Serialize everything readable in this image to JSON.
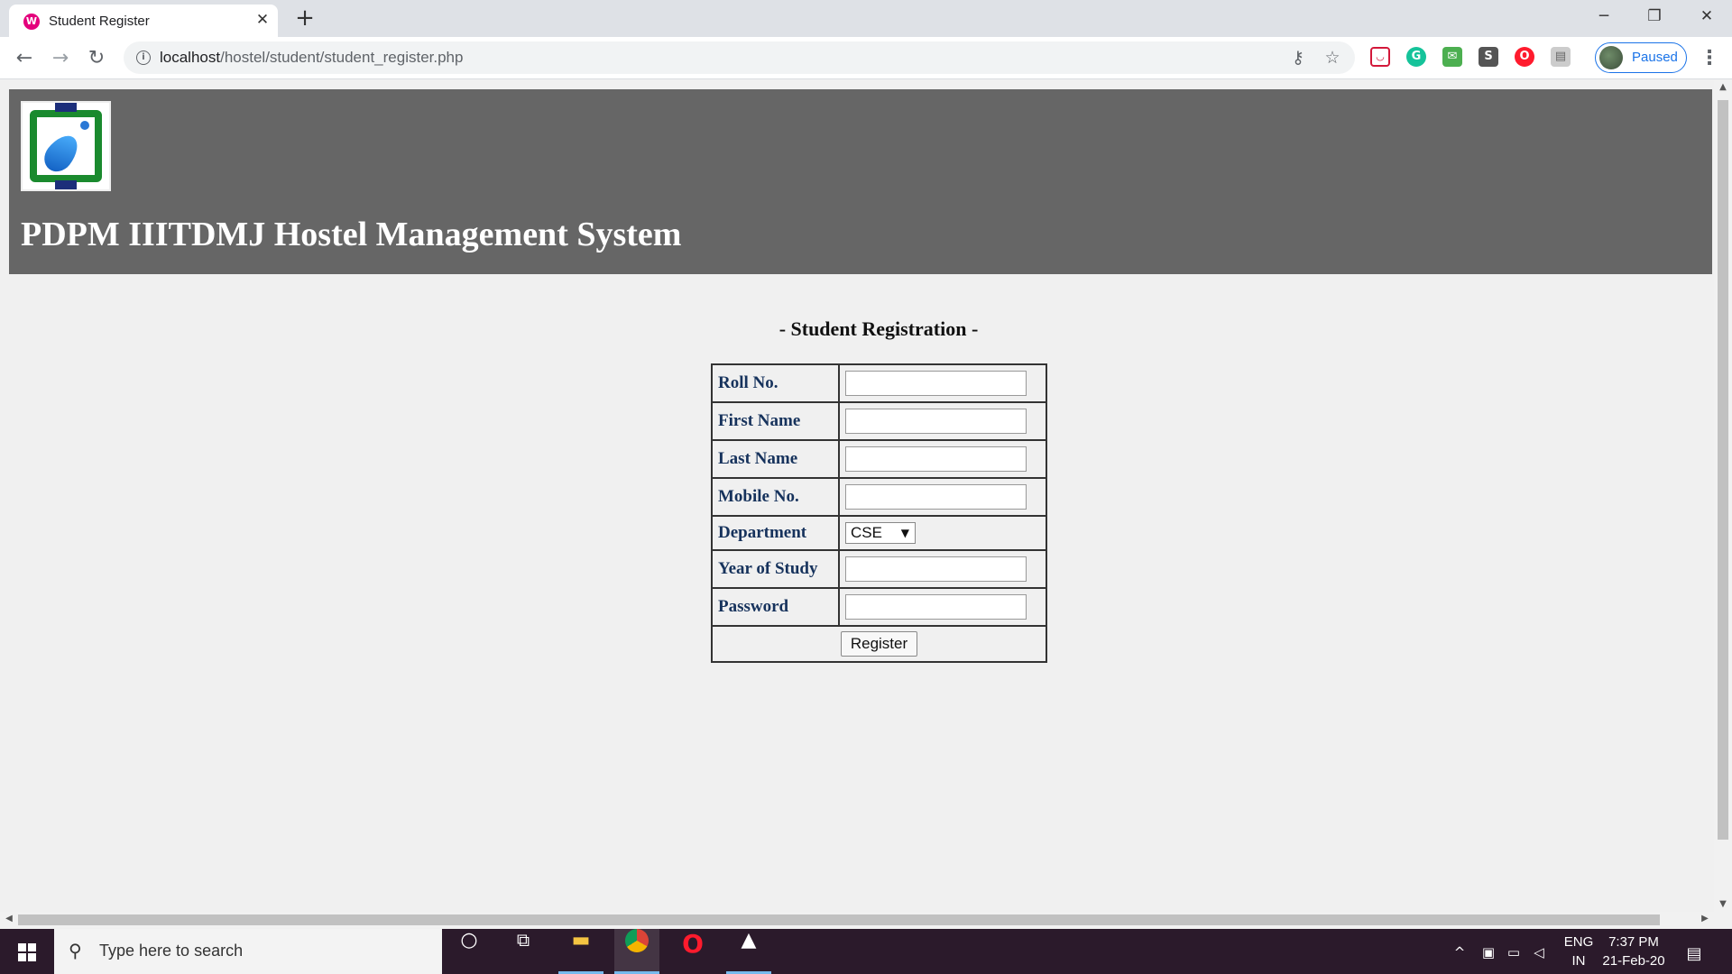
{
  "browser": {
    "tab_title": "Student Register",
    "tab_close": "✕",
    "new_tab": "+",
    "url_host": "localhost",
    "url_path": "/hostel/student/student_register.php",
    "profile_label": "Paused",
    "window_buttons": {
      "minimize": "─",
      "restore": "❐",
      "close": "✕"
    }
  },
  "page": {
    "site_title": "PDPM IIITDMJ Hostel Management System",
    "form_heading": "- Student Registration -",
    "fields": [
      {
        "label": "Roll No.",
        "value": ""
      },
      {
        "label": "First Name",
        "value": ""
      },
      {
        "label": "Last Name",
        "value": ""
      },
      {
        "label": "Mobile No.",
        "value": ""
      },
      {
        "label": "Department",
        "value": "CSE"
      },
      {
        "label": "Year of Study",
        "value": ""
      },
      {
        "label": "Password",
        "value": ""
      }
    ],
    "register_label": "Register"
  },
  "taskbar": {
    "search_placeholder": "Type here to search",
    "lang_top": "ENG",
    "lang_bottom": "IN",
    "time": "7:37 PM",
    "date": "21-Feb-20"
  },
  "colors": {
    "header_bg": "#666666",
    "label_color": "#16325c",
    "accent": "#1a73e8",
    "taskbar_bg": "#2b1a2b"
  },
  "icons": [
    "site-favicon-icon",
    "back-icon",
    "forward-icon",
    "reload-icon",
    "info-icon",
    "key-icon",
    "star-icon",
    "pocket-icon",
    "grammarly-icon",
    "sheets-icon",
    "scribd-icon",
    "opera-icon",
    "extension-icon",
    "windows-icon",
    "search-icon",
    "cortana-icon",
    "task-view-icon",
    "file-explorer-icon",
    "chrome-icon",
    "opera-browser-icon",
    "photos-icon",
    "notification-icon"
  ]
}
